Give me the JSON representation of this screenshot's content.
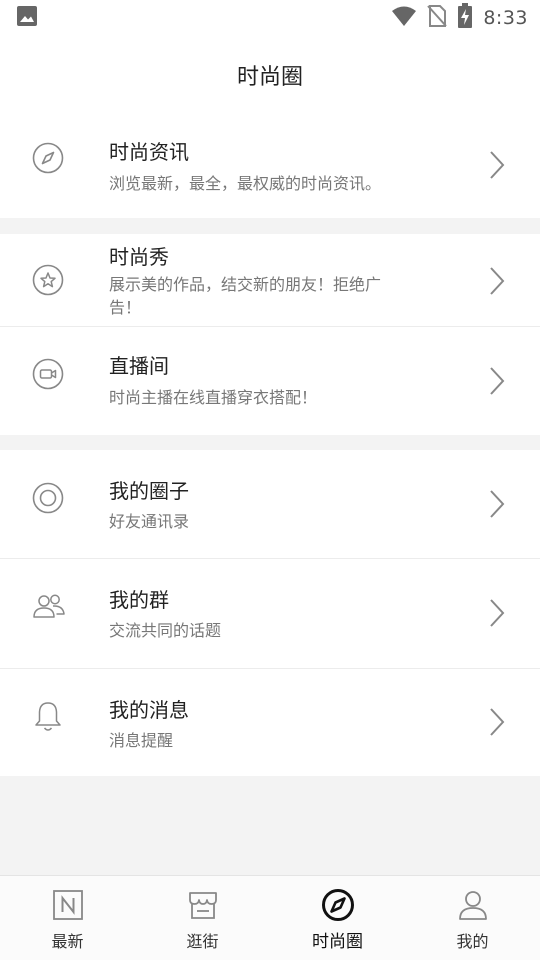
{
  "status_bar": {
    "time": "8:33",
    "icons": [
      "gallery-icon",
      "wifi-icon",
      "no-sim-icon",
      "battery-charging-icon"
    ]
  },
  "header": {
    "title": "时尚圈"
  },
  "menu": [
    {
      "icon": "compass-icon",
      "title": "时尚资讯",
      "subtitle": "浏览最新，最全，最权威的时尚资讯。"
    },
    {
      "icon": "star-circle-icon",
      "title": "时尚秀",
      "subtitle": "展示美的作品，结交新的朋友！拒绝广告！"
    },
    {
      "icon": "video-camera-icon",
      "title": "直播间",
      "subtitle": "时尚主播在线直播穿衣搭配！"
    },
    {
      "icon": "circle-target-icon",
      "title": "我的圈子",
      "subtitle": "好友通讯录"
    },
    {
      "icon": "people-icon",
      "title": "我的群",
      "subtitle": "交流共同的话题"
    },
    {
      "icon": "bell-icon",
      "title": "我的消息",
      "subtitle": "消息提醒"
    }
  ],
  "tabbar": {
    "tabs": [
      {
        "icon": "news-n-icon",
        "label": "最新"
      },
      {
        "icon": "store-icon",
        "label": "逛街"
      },
      {
        "icon": "compass-filled-icon",
        "label": "时尚圈"
      },
      {
        "icon": "person-icon",
        "label": "我的"
      }
    ],
    "active_index": 2
  },
  "colors": {
    "background": "#f3f3f3",
    "surface": "#ffffff",
    "icon_gray": "#888888",
    "title": "#222222",
    "subtitle": "#777777"
  }
}
